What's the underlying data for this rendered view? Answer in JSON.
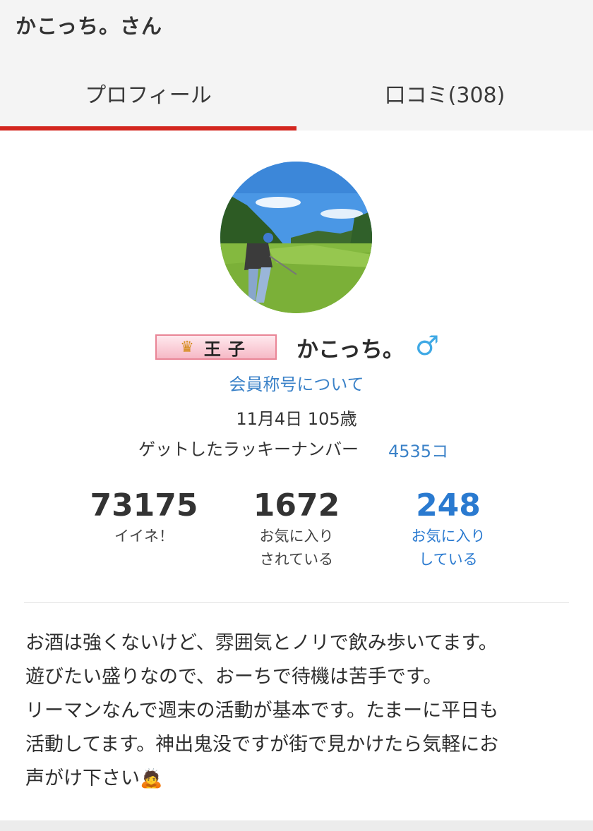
{
  "header": {
    "title": "かこっち。さん"
  },
  "tabs": [
    {
      "label": "プロフィール",
      "active": true
    },
    {
      "label": "口コミ(308)",
      "active": false
    }
  ],
  "colors": {
    "accent": "#d3261f",
    "link": "#3b82c8",
    "male": "#3fa9e5"
  },
  "profile": {
    "avatar_icon": "golfer-photo",
    "badge": {
      "icon": "crown-icon",
      "text": "王子"
    },
    "name": "かこっち。",
    "gender_icon": "male-icon",
    "gender_symbol": "♂",
    "rank_link": "会員称号について",
    "birthday": "11月4日 105歳",
    "lucky_label": "ゲットしたラッキーナンバー",
    "lucky_value": "4535コ"
  },
  "stats": [
    {
      "number": "73175",
      "label_1": "イイネ！",
      "label_2": ""
    },
    {
      "number": "1672",
      "label_1": "お気に入り",
      "label_2": "されている"
    },
    {
      "number": "248",
      "label_1": "お気に入り",
      "label_2": "している"
    }
  ],
  "bio": {
    "lines": [
      "お酒は強くないけど、雰囲気とノリで飲み歩いてます。",
      "遊びたい盛りなので、おーちで待機は苦手です。",
      "リーマンなんで週末の活動が基本です。たまーに平日も",
      "活動してます。神出鬼没ですが街で見かけたら気軽にお",
      "声がけ下さい"
    ],
    "end_icon": "bowing-person-icon"
  }
}
